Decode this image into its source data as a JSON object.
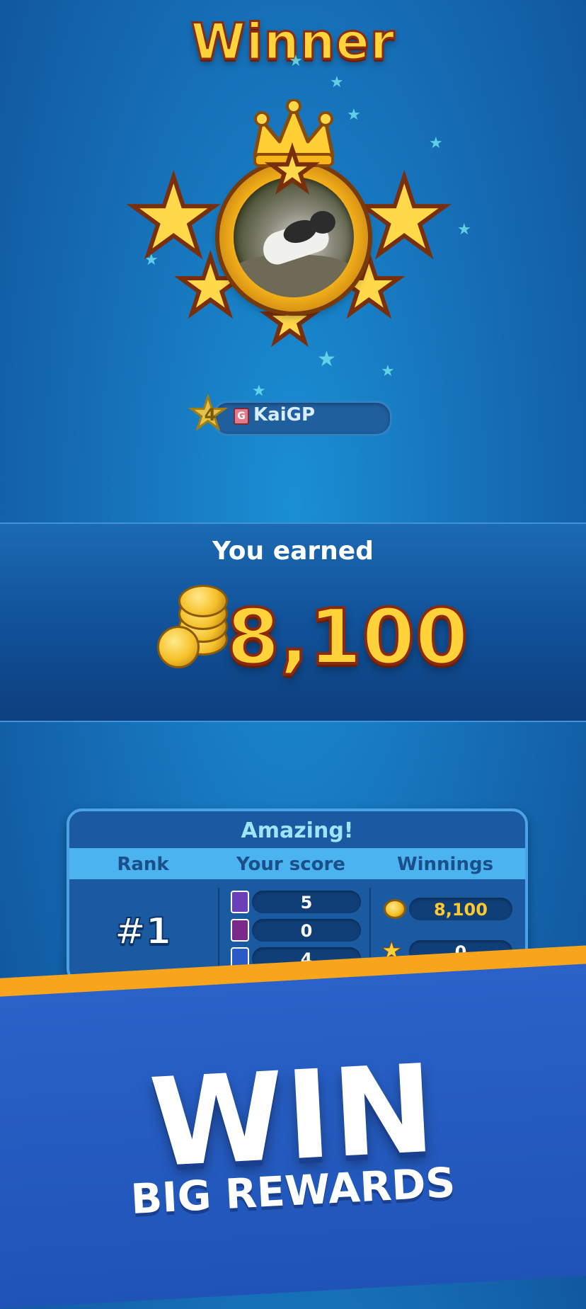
{
  "title": "Winner",
  "player": {
    "level": "4",
    "name": "KaiGP"
  },
  "earnings": {
    "label": "You earned",
    "amount": "8,100"
  },
  "results": {
    "title": "Amazing!",
    "headers": {
      "rank": "Rank",
      "score": "Your score",
      "winnings": "Winnings"
    },
    "rank": "#1",
    "scores": [
      "5",
      "0",
      "4"
    ],
    "winnings_coins": "8,100",
    "winnings_stars": "0"
  },
  "promo": {
    "headline": "WIN",
    "subline": "BIG REWARDS"
  },
  "colors": {
    "gold": "#ffd23a",
    "accent_blue": "#4ab3f0",
    "orange_stripe": "#f6a51c"
  }
}
